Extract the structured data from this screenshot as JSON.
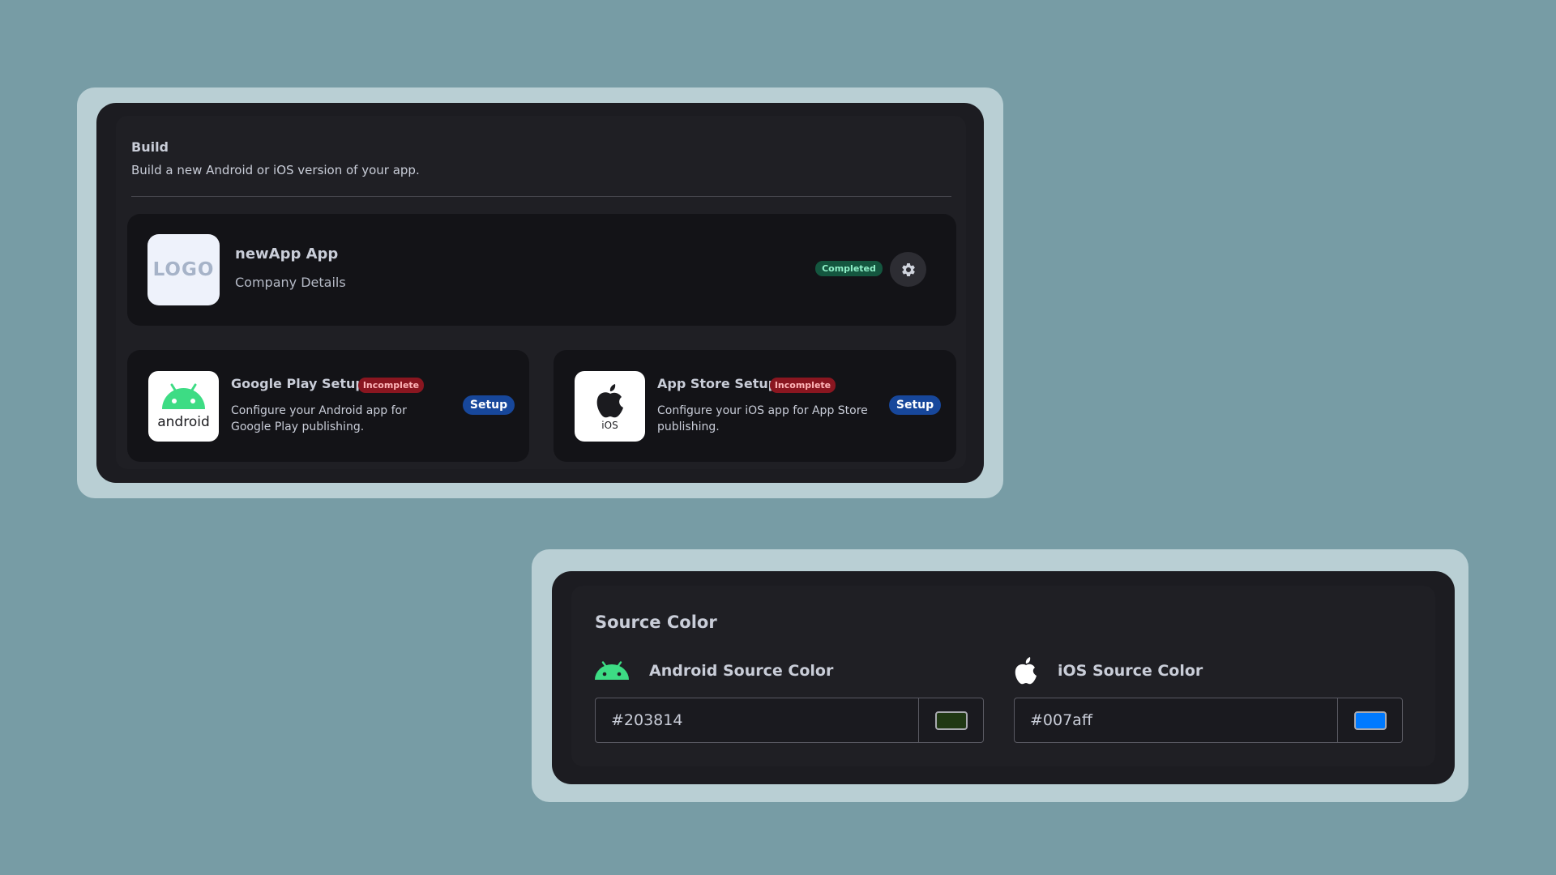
{
  "build": {
    "title": "Build",
    "subtitle": "Build a new Android or iOS version of your app.",
    "company": {
      "logo_text": "LOGO",
      "name": "newApp App",
      "subtitle": "Company Details",
      "status": "Completed",
      "settings_icon": "gear-icon"
    },
    "google_play": {
      "icon_caption": "android",
      "title": "Google Play Setup",
      "status": "Incomplete",
      "description": "Configure your Android app for Google Play publishing.",
      "button": "Setup"
    },
    "app_store": {
      "icon_caption": "iOS",
      "title": "App Store Setup",
      "status": "Incomplete",
      "description": "Configure your iOS app for App Store publishing.",
      "button": "Setup"
    }
  },
  "source_color": {
    "title": "Source Color",
    "android": {
      "label": "Android Source Color",
      "value": "#203814",
      "swatch": "#203814"
    },
    "ios": {
      "label": "iOS Source Color",
      "value": "#007aff",
      "swatch": "#007aff"
    }
  },
  "colors": {
    "completed_badge": "#14563f",
    "incomplete_badge": "#8a1620",
    "setup_button": "#17479b",
    "android_green": "#3ddc84"
  }
}
